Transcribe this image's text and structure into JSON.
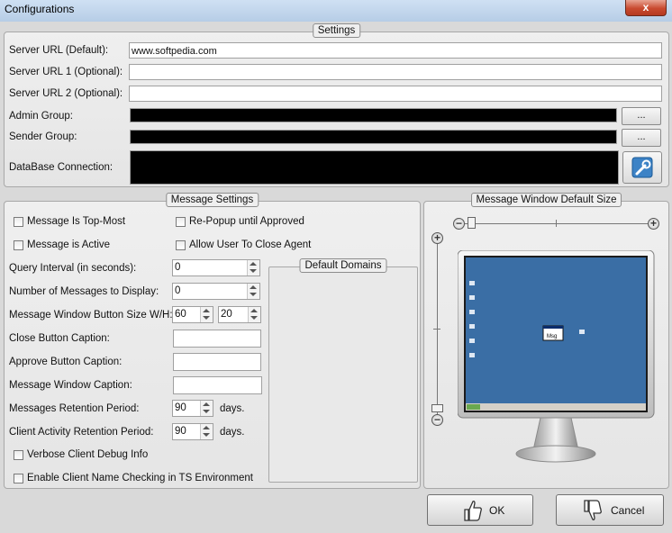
{
  "window": {
    "title": "Configurations",
    "close_glyph": "x"
  },
  "settings": {
    "title": "Settings",
    "server_url_default": {
      "label": "Server URL (Default):",
      "value": "www.softpedia.com"
    },
    "server_url_1": {
      "label": "Server URL 1 (Optional):",
      "value": ""
    },
    "server_url_2": {
      "label": "Server URL 2 (Optional):",
      "value": ""
    },
    "admin_group": {
      "label": "Admin Group:",
      "button": "..."
    },
    "sender_group": {
      "label": "Sender Group:",
      "button": "..."
    },
    "database_connection": {
      "label": "DataBase Connection:"
    }
  },
  "message_settings": {
    "title": "Message Settings",
    "top_most": "Message Is Top-Most",
    "re_popup": "Re-Popup until Approved",
    "is_active": "Message is Active",
    "allow_close": "Allow User To Close Agent",
    "query_interval": {
      "label": "Query Interval (in seconds):",
      "value": "0"
    },
    "num_messages": {
      "label": "Number of Messages to Display:",
      "value": "0"
    },
    "button_size": {
      "label": "Message Window Button Size W/H:",
      "width": "60",
      "height": "20"
    },
    "close_caption": {
      "label": "Close Button Caption:",
      "value": ""
    },
    "approve_caption": {
      "label": "Approve Button Caption:",
      "value": ""
    },
    "window_caption": {
      "label": "Message Window Caption:",
      "value": ""
    },
    "retention": {
      "label": "Messages Retention Period:",
      "value": "90",
      "unit": "days."
    },
    "client_retention": {
      "label": "Client Activity Retention Period:",
      "value": "90",
      "unit": "days."
    },
    "verbose": "Verbose Client Debug Info",
    "name_check": "Enable Client Name Checking in TS Environment",
    "default_domains": "Default Domains"
  },
  "window_size": {
    "title": "Message Window Default Size",
    "minus": "−",
    "plus": "+",
    "preview_label": "Msg"
  },
  "buttons": {
    "ok": "OK",
    "cancel": "Cancel"
  },
  "colors": {
    "desktop": "#3a6ea5",
    "taskbar": "#d4d0c8",
    "ok_accent": "#333333"
  }
}
